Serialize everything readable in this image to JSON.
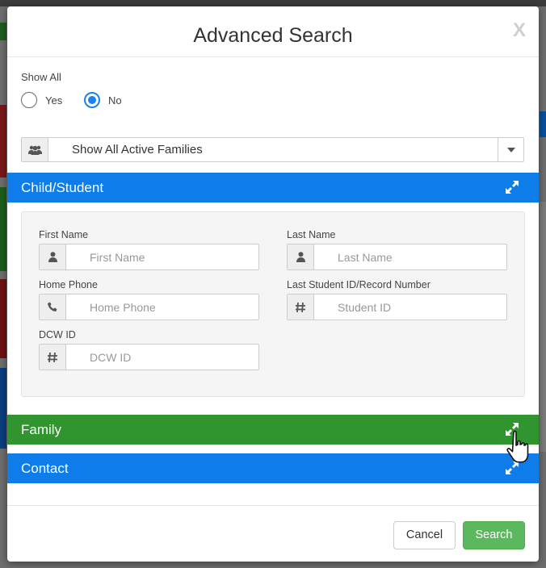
{
  "modal": {
    "title": "Advanced Search",
    "close_label": "X"
  },
  "show_all": {
    "label": "Show All",
    "options": [
      {
        "label": "Yes",
        "checked": false
      },
      {
        "label": "No",
        "checked": true
      }
    ]
  },
  "family_filter": {
    "icon": "users-icon",
    "selected": "Show All Active Families"
  },
  "sections": {
    "child": {
      "title": "Child/Student",
      "color": "#0f7de9"
    },
    "family": {
      "title": "Family",
      "color": "#30952e"
    },
    "contact": {
      "title": "Contact",
      "color": "#0f7de9"
    }
  },
  "child_fields": {
    "first_name": {
      "label": "First Name",
      "placeholder": "First Name",
      "icon": "user-icon"
    },
    "last_name": {
      "label": "Last Name",
      "placeholder": "Last Name",
      "icon": "user-icon"
    },
    "home_phone": {
      "label": "Home Phone",
      "placeholder": "Home Phone",
      "icon": "phone-icon"
    },
    "student_id": {
      "label": "Last Student ID/Record Number",
      "placeholder": "Student ID",
      "icon": "hash-icon"
    },
    "dcw_id": {
      "label": "DCW ID",
      "placeholder": "DCW ID",
      "icon": "hash-icon"
    }
  },
  "footer": {
    "cancel_label": "Cancel",
    "search_label": "Search",
    "search_color": "#5cb85c"
  }
}
